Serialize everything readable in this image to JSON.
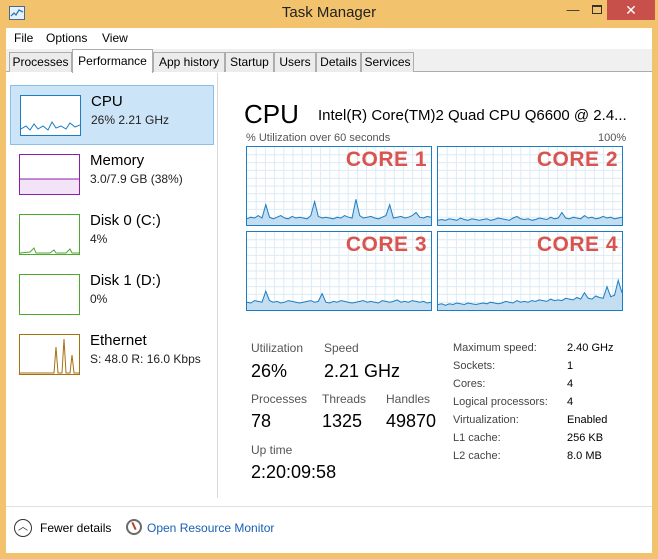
{
  "window": {
    "title": "Task Manager",
    "minimize_glyph": "—",
    "close_glyph": "✕"
  },
  "menu": [
    "File",
    "Options",
    "View"
  ],
  "tabs": [
    {
      "label": "Processes",
      "active": false
    },
    {
      "label": "Performance",
      "active": true
    },
    {
      "label": "App history",
      "active": false
    },
    {
      "label": "Startup",
      "active": false
    },
    {
      "label": "Users",
      "active": false
    },
    {
      "label": "Details",
      "active": false
    },
    {
      "label": "Services",
      "active": false
    }
  ],
  "sidebar": {
    "items": [
      {
        "title": "CPU",
        "subtitle": "26% 2.21 GHz",
        "selected": true,
        "color": "#1b7ec4"
      },
      {
        "title": "Memory",
        "subtitle": "3.0/7.9 GB (38%)",
        "selected": false,
        "color": "#8b1fa9"
      },
      {
        "title": "Disk 0 (C:)",
        "subtitle": "4%",
        "selected": false,
        "color": "#4ea72e"
      },
      {
        "title": "Disk 1 (D:)",
        "subtitle": "0%",
        "selected": false,
        "color": "#4ea72e"
      },
      {
        "title": "Ethernet",
        "subtitle": "S: 48.0  R: 16.0 Kbps",
        "selected": false,
        "color": "#a5700f"
      }
    ]
  },
  "main": {
    "title": "CPU",
    "cpu_name": "Intel(R) Core(TM)2 Quad CPU Q6600 @ 2.4...",
    "util_label": "% Utilization over 60 seconds",
    "util_max": "100%",
    "cores": [
      {
        "label": "CORE 1",
        "usage": [
          8,
          10,
          9,
          12,
          9,
          26,
          10,
          8,
          10,
          12,
          9,
          8,
          11,
          9,
          10,
          9,
          8,
          12,
          30,
          11,
          9,
          10,
          9,
          8,
          10,
          9,
          12,
          10,
          9,
          33,
          12,
          9,
          10,
          11,
          9,
          8,
          10,
          12,
          26,
          9,
          10,
          11,
          9,
          10,
          12,
          16,
          10,
          9,
          11,
          10
        ]
      },
      {
        "label": "CORE 2",
        "usage": [
          6,
          7,
          6,
          8,
          7,
          6,
          9,
          7,
          6,
          8,
          7,
          6,
          7,
          8,
          6,
          7,
          9,
          8,
          7,
          6,
          9,
          11,
          8,
          7,
          8,
          6,
          7,
          9,
          8,
          7,
          10,
          8,
          9,
          16,
          9,
          8,
          10,
          9,
          8,
          12,
          9,
          10,
          8,
          9,
          11,
          9,
          10,
          8,
          9,
          10
        ]
      },
      {
        "label": "CORE 3",
        "usage": [
          10,
          9,
          12,
          11,
          10,
          24,
          12,
          10,
          11,
          9,
          10,
          12,
          11,
          10,
          9,
          10,
          11,
          12,
          10,
          11,
          21,
          10,
          9,
          11,
          10,
          12,
          11,
          10,
          9,
          10,
          11,
          12,
          10,
          11,
          10,
          9,
          12,
          11,
          10,
          11,
          13,
          10,
          11,
          10,
          12,
          11,
          10,
          11,
          9,
          10
        ]
      },
      {
        "label": "CORE 4",
        "usage": [
          7,
          8,
          6,
          8,
          7,
          9,
          8,
          7,
          9,
          8,
          7,
          8,
          9,
          8,
          10,
          9,
          8,
          9,
          11,
          10,
          9,
          12,
          10,
          11,
          10,
          12,
          11,
          13,
          12,
          11,
          14,
          12,
          13,
          12,
          15,
          14,
          13,
          16,
          14,
          22,
          15,
          14,
          18,
          16,
          15,
          30,
          17,
          19,
          38,
          22
        ]
      }
    ],
    "stats": {
      "utilization_label": "Utilization",
      "utilization": "26%",
      "speed_label": "Speed",
      "speed": "2.21 GHz",
      "processes_label": "Processes",
      "processes": "78",
      "threads_label": "Threads",
      "threads": "1325",
      "handles_label": "Handles",
      "handles": "49870",
      "uptime_label": "Up time",
      "uptime": "2:20:09:58"
    },
    "specs": [
      {
        "label": "Maximum speed:",
        "value": "2.40 GHz"
      },
      {
        "label": "Sockets:",
        "value": "1"
      },
      {
        "label": "Cores:",
        "value": "4"
      },
      {
        "label": "Logical processors:",
        "value": "4"
      },
      {
        "label": "Virtualization:",
        "value": "Enabled"
      },
      {
        "label": "L1 cache:",
        "value": "256 KB"
      },
      {
        "label": "L2 cache:",
        "value": "8.0 MB"
      }
    ]
  },
  "footer": {
    "fewer_details": "Fewer details",
    "fewer_glyph": "︿",
    "resource_monitor": "Open Resource Monitor"
  },
  "colors": {
    "titlebar": "#f2c36c",
    "close_button": "#c7504b",
    "graph_line": "#1b7ec4",
    "graph_fill": "#c3ddf1",
    "core_label": "#d9534f",
    "selection": "#cce4f7"
  }
}
